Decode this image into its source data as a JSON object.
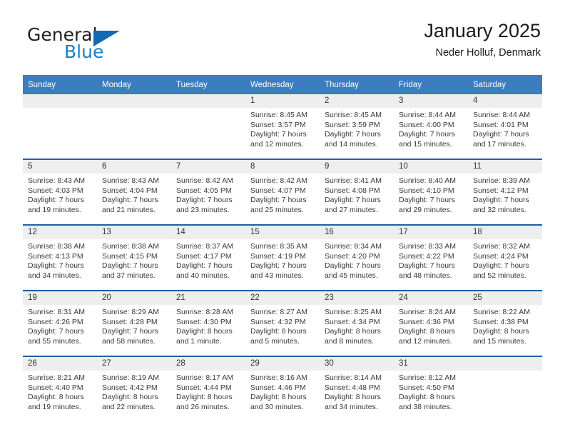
{
  "brand": {
    "word_one": "General",
    "word_two": "Blue",
    "triangle_icon": "triangle-icon",
    "accent_color": "#1268b3"
  },
  "header": {
    "title": "January 2025",
    "subtitle": "Neder Holluf, Denmark"
  },
  "calendar": {
    "header_color": "#3c7dbf",
    "cell_border_color": "#1f5fa9",
    "date_band_color": "#eeeeee",
    "weekday_headers": [
      "Sunday",
      "Monday",
      "Tuesday",
      "Wednesday",
      "Thursday",
      "Friday",
      "Saturday"
    ],
    "weeks": [
      [
        {
          "date": "",
          "lines": []
        },
        {
          "date": "",
          "lines": []
        },
        {
          "date": "",
          "lines": []
        },
        {
          "date": "1",
          "lines": [
            "Sunrise: 8:45 AM",
            "Sunset: 3:57 PM",
            "Daylight: 7 hours",
            "and 12 minutes."
          ]
        },
        {
          "date": "2",
          "lines": [
            "Sunrise: 8:45 AM",
            "Sunset: 3:59 PM",
            "Daylight: 7 hours",
            "and 14 minutes."
          ]
        },
        {
          "date": "3",
          "lines": [
            "Sunrise: 8:44 AM",
            "Sunset: 4:00 PM",
            "Daylight: 7 hours",
            "and 15 minutes."
          ]
        },
        {
          "date": "4",
          "lines": [
            "Sunrise: 8:44 AM",
            "Sunset: 4:01 PM",
            "Daylight: 7 hours",
            "and 17 minutes."
          ]
        }
      ],
      [
        {
          "date": "5",
          "lines": [
            "Sunrise: 8:43 AM",
            "Sunset: 4:03 PM",
            "Daylight: 7 hours",
            "and 19 minutes."
          ]
        },
        {
          "date": "6",
          "lines": [
            "Sunrise: 8:43 AM",
            "Sunset: 4:04 PM",
            "Daylight: 7 hours",
            "and 21 minutes."
          ]
        },
        {
          "date": "7",
          "lines": [
            "Sunrise: 8:42 AM",
            "Sunset: 4:05 PM",
            "Daylight: 7 hours",
            "and 23 minutes."
          ]
        },
        {
          "date": "8",
          "lines": [
            "Sunrise: 8:42 AM",
            "Sunset: 4:07 PM",
            "Daylight: 7 hours",
            "and 25 minutes."
          ]
        },
        {
          "date": "9",
          "lines": [
            "Sunrise: 8:41 AM",
            "Sunset: 4:08 PM",
            "Daylight: 7 hours",
            "and 27 minutes."
          ]
        },
        {
          "date": "10",
          "lines": [
            "Sunrise: 8:40 AM",
            "Sunset: 4:10 PM",
            "Daylight: 7 hours",
            "and 29 minutes."
          ]
        },
        {
          "date": "11",
          "lines": [
            "Sunrise: 8:39 AM",
            "Sunset: 4:12 PM",
            "Daylight: 7 hours",
            "and 32 minutes."
          ]
        }
      ],
      [
        {
          "date": "12",
          "lines": [
            "Sunrise: 8:38 AM",
            "Sunset: 4:13 PM",
            "Daylight: 7 hours",
            "and 34 minutes."
          ]
        },
        {
          "date": "13",
          "lines": [
            "Sunrise: 8:38 AM",
            "Sunset: 4:15 PM",
            "Daylight: 7 hours",
            "and 37 minutes."
          ]
        },
        {
          "date": "14",
          "lines": [
            "Sunrise: 8:37 AM",
            "Sunset: 4:17 PM",
            "Daylight: 7 hours",
            "and 40 minutes."
          ]
        },
        {
          "date": "15",
          "lines": [
            "Sunrise: 8:35 AM",
            "Sunset: 4:19 PM",
            "Daylight: 7 hours",
            "and 43 minutes."
          ]
        },
        {
          "date": "16",
          "lines": [
            "Sunrise: 8:34 AM",
            "Sunset: 4:20 PM",
            "Daylight: 7 hours",
            "and 45 minutes."
          ]
        },
        {
          "date": "17",
          "lines": [
            "Sunrise: 8:33 AM",
            "Sunset: 4:22 PM",
            "Daylight: 7 hours",
            "and 48 minutes."
          ]
        },
        {
          "date": "18",
          "lines": [
            "Sunrise: 8:32 AM",
            "Sunset: 4:24 PM",
            "Daylight: 7 hours",
            "and 52 minutes."
          ]
        }
      ],
      [
        {
          "date": "19",
          "lines": [
            "Sunrise: 8:31 AM",
            "Sunset: 4:26 PM",
            "Daylight: 7 hours",
            "and 55 minutes."
          ]
        },
        {
          "date": "20",
          "lines": [
            "Sunrise: 8:29 AM",
            "Sunset: 4:28 PM",
            "Daylight: 7 hours",
            "and 58 minutes."
          ]
        },
        {
          "date": "21",
          "lines": [
            "Sunrise: 8:28 AM",
            "Sunset: 4:30 PM",
            "Daylight: 8 hours",
            "and 1 minute."
          ]
        },
        {
          "date": "22",
          "lines": [
            "Sunrise: 8:27 AM",
            "Sunset: 4:32 PM",
            "Daylight: 8 hours",
            "and 5 minutes."
          ]
        },
        {
          "date": "23",
          "lines": [
            "Sunrise: 8:25 AM",
            "Sunset: 4:34 PM",
            "Daylight: 8 hours",
            "and 8 minutes."
          ]
        },
        {
          "date": "24",
          "lines": [
            "Sunrise: 8:24 AM",
            "Sunset: 4:36 PM",
            "Daylight: 8 hours",
            "and 12 minutes."
          ]
        },
        {
          "date": "25",
          "lines": [
            "Sunrise: 8:22 AM",
            "Sunset: 4:38 PM",
            "Daylight: 8 hours",
            "and 15 minutes."
          ]
        }
      ],
      [
        {
          "date": "26",
          "lines": [
            "Sunrise: 8:21 AM",
            "Sunset: 4:40 PM",
            "Daylight: 8 hours",
            "and 19 minutes."
          ]
        },
        {
          "date": "27",
          "lines": [
            "Sunrise: 8:19 AM",
            "Sunset: 4:42 PM",
            "Daylight: 8 hours",
            "and 22 minutes."
          ]
        },
        {
          "date": "28",
          "lines": [
            "Sunrise: 8:17 AM",
            "Sunset: 4:44 PM",
            "Daylight: 8 hours",
            "and 26 minutes."
          ]
        },
        {
          "date": "29",
          "lines": [
            "Sunrise: 8:16 AM",
            "Sunset: 4:46 PM",
            "Daylight: 8 hours",
            "and 30 minutes."
          ]
        },
        {
          "date": "30",
          "lines": [
            "Sunrise: 8:14 AM",
            "Sunset: 4:48 PM",
            "Daylight: 8 hours",
            "and 34 minutes."
          ]
        },
        {
          "date": "31",
          "lines": [
            "Sunrise: 8:12 AM",
            "Sunset: 4:50 PM",
            "Daylight: 8 hours",
            "and 38 minutes."
          ]
        },
        {
          "date": "",
          "lines": []
        }
      ]
    ]
  }
}
